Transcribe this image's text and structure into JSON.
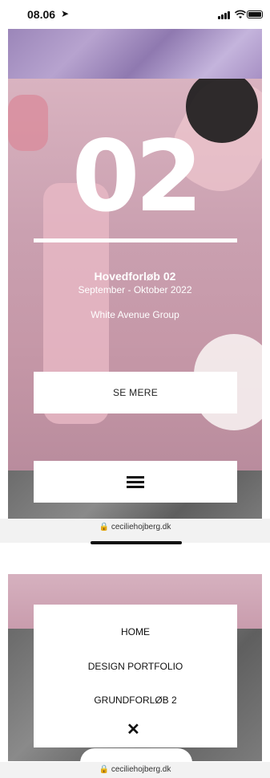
{
  "status": {
    "time": "08.06",
    "location_icon": "location-arrow-icon"
  },
  "hero": {
    "number": "02",
    "title": "Hovedforløb 02",
    "dates": "September - Oktober 2022",
    "group": "White Avenue Group",
    "button_label": "SE MERE"
  },
  "browser": {
    "url": "ceciliehojberg.dk"
  },
  "menu": {
    "items": [
      {
        "label": "HOME"
      },
      {
        "label": "DESIGN PORTFOLIO"
      },
      {
        "label": "GRUNDFORLØB 2"
      }
    ],
    "close_label": "✕"
  },
  "colors": {
    "accent": "#ffffff",
    "hero_pink": "#c597a7",
    "marble": "#6c6c6c"
  }
}
